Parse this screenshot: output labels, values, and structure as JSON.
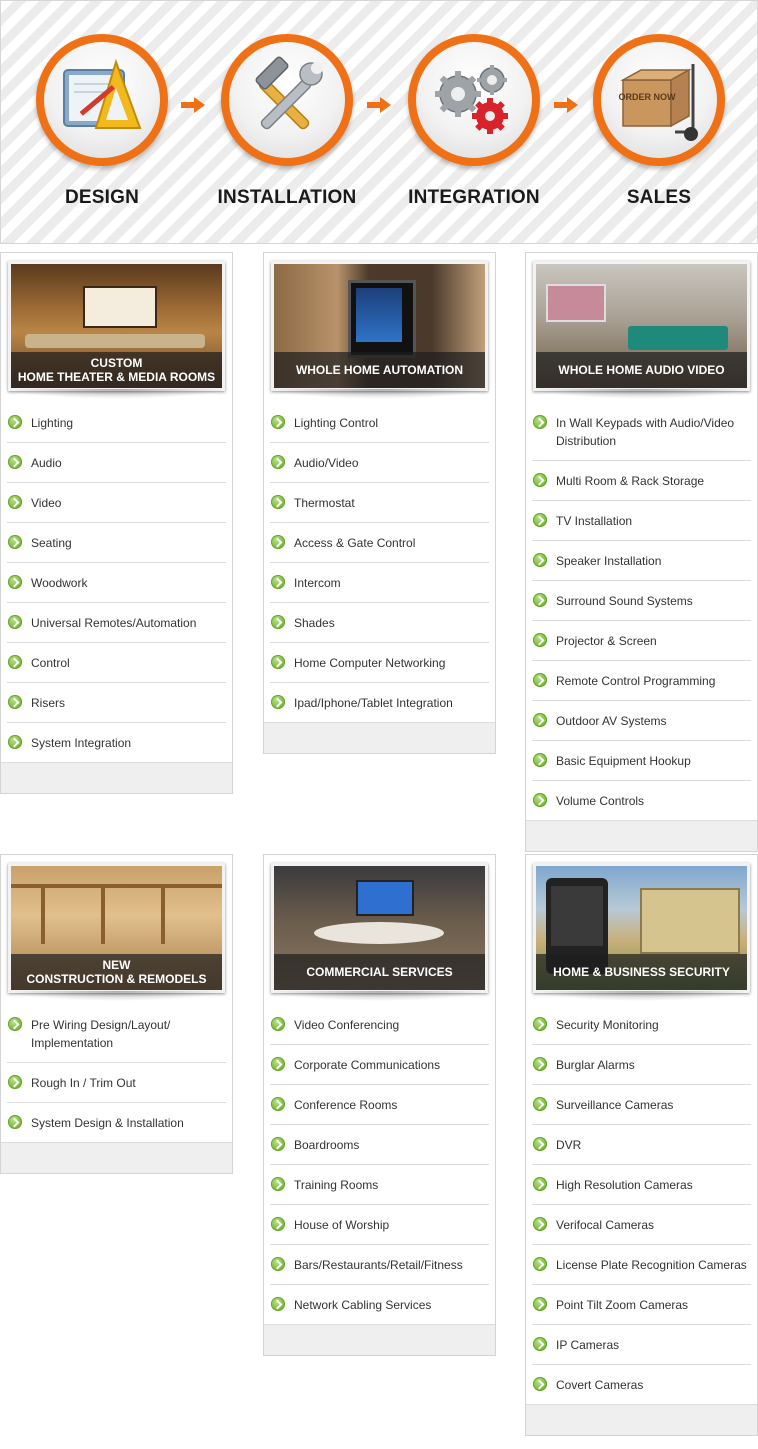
{
  "process": {
    "steps": [
      {
        "label": "DESIGN",
        "icon": "drafting-tools-icon"
      },
      {
        "label": "INSTALLATION",
        "icon": "hammer-wrench-icon"
      },
      {
        "label": "INTEGRATION",
        "icon": "gears-icon"
      },
      {
        "label": "SALES",
        "icon": "order-now-box-icon"
      }
    ],
    "box_text": "ORDER NOW"
  },
  "colors": {
    "accent": "#f07016",
    "bullet": "#7cbc3a"
  },
  "cards": [
    {
      "title_line1": "CUSTOM",
      "title_line2": "HOME THEATER & MEDIA ROOMS",
      "items": [
        "Lighting",
        "Audio",
        "Video",
        "Seating",
        "Woodwork",
        "Universal Remotes/Automation",
        "Control",
        "Risers",
        "System Integration"
      ]
    },
    {
      "title_line1": "",
      "title_line2": "WHOLE HOME AUTOMATION",
      "items": [
        "Lighting Control",
        "Audio/Video",
        "Thermostat",
        "Access & Gate Control",
        "Intercom",
        "Shades",
        "Home Computer Networking",
        "Ipad/Iphone/Tablet Integration"
      ]
    },
    {
      "title_line1": "",
      "title_line2": "WHOLE HOME AUDIO VIDEO",
      "items": [
        "In Wall Keypads with Audio/Video Distribution",
        "Multi Room & Rack Storage",
        "TV Installation",
        "Speaker Installation",
        "Surround Sound Systems",
        "Projector & Screen",
        "Remote Control Programming",
        "Outdoor AV Systems",
        "Basic Equipment Hookup",
        "Volume Controls"
      ]
    },
    {
      "title_line1": "NEW",
      "title_line2": "CONSTRUCTION & REMODELS",
      "items": [
        "Pre Wiring Design/Layout/ Implementation",
        "Rough In / Trim Out",
        "System Design & Installation"
      ]
    },
    {
      "title_line1": "",
      "title_line2": "COMMERCIAL SERVICES",
      "items": [
        "Video Conferencing",
        "Corporate Communications",
        "Conference Rooms",
        "Boardrooms",
        "Training Rooms",
        "House of Worship",
        "Bars/Restaurants/Retail/Fitness",
        "Network Cabling Services"
      ]
    },
    {
      "title_line1": "",
      "title_line2": "HOME & BUSINESS SECURITY",
      "items": [
        "Security Monitoring",
        "Burglar Alarms",
        "Surveillance Cameras",
        "DVR",
        "High Resolution Cameras",
        "Verifocal Cameras",
        "License Plate Recognition Cameras",
        "Point Tilt Zoom Cameras",
        "IP Cameras",
        "Covert Cameras"
      ]
    }
  ]
}
